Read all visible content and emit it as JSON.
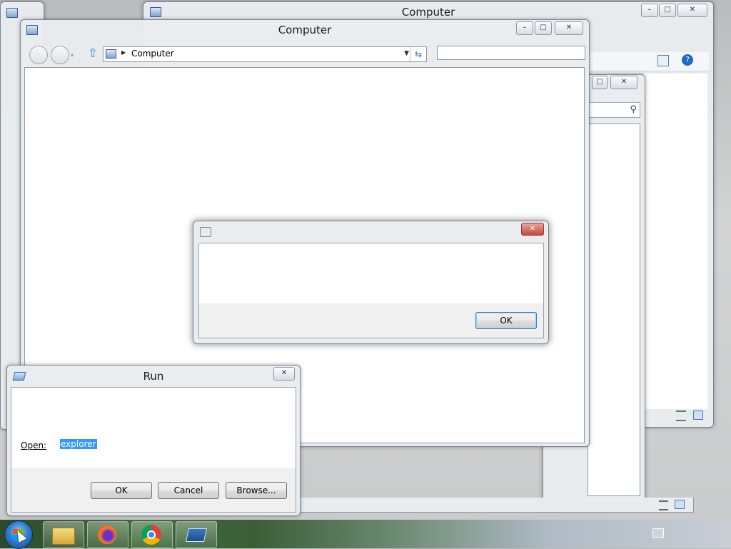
{
  "desktop": {
    "back_window": {
      "title": "Computer"
    },
    "main_window": {
      "title": "Computer",
      "address": {
        "crumb": "Computer"
      },
      "search": {
        "value": ""
      }
    },
    "message_dialog": {
      "ok_label": "OK"
    },
    "run_dialog": {
      "title": "Run",
      "open_label": "Open:",
      "input_value": "explorer",
      "ok_label": "OK",
      "cancel_label": "Cancel",
      "browse_label": "Browse..."
    }
  },
  "taskbar": {
    "items": [
      "start-orb",
      "windows-explorer",
      "firefox",
      "chrome",
      "run"
    ]
  },
  "colors": {
    "selection": "#3399ff",
    "default_button_border": "#3c7fb1"
  }
}
